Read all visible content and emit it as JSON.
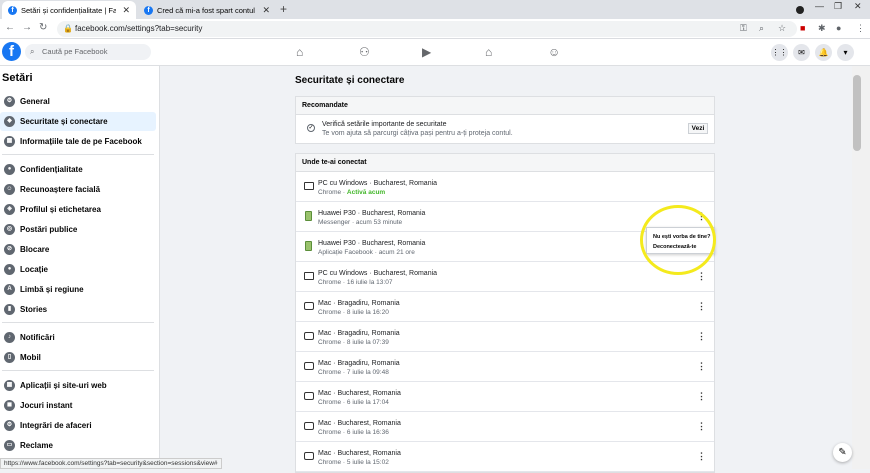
{
  "browser": {
    "tabs": [
      {
        "title": "Setări și confidențialitate | Faceb",
        "favicon": "f"
      },
      {
        "title": "Cred că mi-a fost spart contul de",
        "favicon": "f"
      }
    ],
    "url": "facebook.com/settings?tab=security",
    "status_url": "https://www.facebook.com/settings?tab=security&section=sessions&view#"
  },
  "fb": {
    "search_placeholder": "Caută pe Facebook",
    "logo": "f"
  },
  "sidebar": {
    "title": "Setări",
    "items": [
      {
        "label": "General",
        "icon": "gear-icon"
      },
      {
        "label": "Securitate și conectare",
        "icon": "shield-icon"
      },
      {
        "label": "Informațiile tale de pe Facebook",
        "icon": "grid-icon"
      },
      {
        "label": "Confidențialitate",
        "icon": "lock-icon"
      },
      {
        "label": "Recunoaștere facială",
        "icon": "face-icon"
      },
      {
        "label": "Profilul și etichetarea",
        "icon": "tag-icon"
      },
      {
        "label": "Postări publice",
        "icon": "globe-icon"
      },
      {
        "label": "Blocare",
        "icon": "block-icon"
      },
      {
        "label": "Locație",
        "icon": "pin-icon"
      },
      {
        "label": "Limbă și regiune",
        "icon": "language-icon"
      },
      {
        "label": "Stories",
        "icon": "book-icon"
      },
      {
        "label": "Notificări",
        "icon": "bell-icon"
      },
      {
        "label": "Mobil",
        "icon": "phone-icon"
      },
      {
        "label": "Aplicații și site-uri web",
        "icon": "apps-icon"
      },
      {
        "label": "Jocuri instant",
        "icon": "game-icon"
      },
      {
        "label": "Integrări de afaceri",
        "icon": "business-icon"
      },
      {
        "label": "Reclame",
        "icon": "ads-icon"
      }
    ]
  },
  "main": {
    "title": "Securitate și conectare",
    "recommended": {
      "header": "Recomandate",
      "line1": "Verifică setările importante de securitate",
      "line2": "Te vom ajuta să parcurgi câțiva pași pentru a-ți proteja contul.",
      "button": "Vezi"
    },
    "sessions_header": "Unde te-ai conectat",
    "sessions": [
      {
        "device": "PC cu Windows · Bucharest, Romania",
        "detail": "Chrome · ",
        "active": "Activă acum",
        "kind": "pc"
      },
      {
        "device": "Huawei P30 · Bucharest, Romania",
        "detail": "Messenger · acum 53 minute",
        "active": "",
        "kind": "phone"
      },
      {
        "device": "Huawei P30 · Bucharest, Romania",
        "detail": "Aplicație Facebook · acum 21 ore",
        "active": "",
        "kind": "phone"
      },
      {
        "device": "PC cu Windows · Bucharest, Romania",
        "detail": "Chrome · 16 iulie la 13:07",
        "active": "",
        "kind": "pc"
      },
      {
        "device": "Mac · Bragadiru, Romania",
        "detail": "Chrome · 8 iulie la 16:20",
        "active": "",
        "kind": "mac"
      },
      {
        "device": "Mac · Bragadiru, Romania",
        "detail": "Chrome · 8 iulie la 07:39",
        "active": "",
        "kind": "mac"
      },
      {
        "device": "Mac · Bragadiru, Romania",
        "detail": "Chrome · 7 iulie la 09:48",
        "active": "",
        "kind": "mac"
      },
      {
        "device": "Mac · Bucharest, Romania",
        "detail": "Chrome · 6 iulie la 17:04",
        "active": "",
        "kind": "mac"
      },
      {
        "device": "Mac · Bucharest, Romania",
        "detail": "Chrome · 6 iulie la 16:36",
        "active": "",
        "kind": "mac"
      },
      {
        "device": "Mac · Bucharest, Romania",
        "detail": "Chrome · 5 iulie la 15:02",
        "active": "",
        "kind": "mac"
      }
    ],
    "context_menu": {
      "item1": "Nu ești vorba de tine?",
      "item2": "Deconectează-te"
    }
  },
  "colors": {
    "fb_blue": "#1877f2",
    "active_green": "#42b72a",
    "highlight": "#f4ea1d"
  }
}
